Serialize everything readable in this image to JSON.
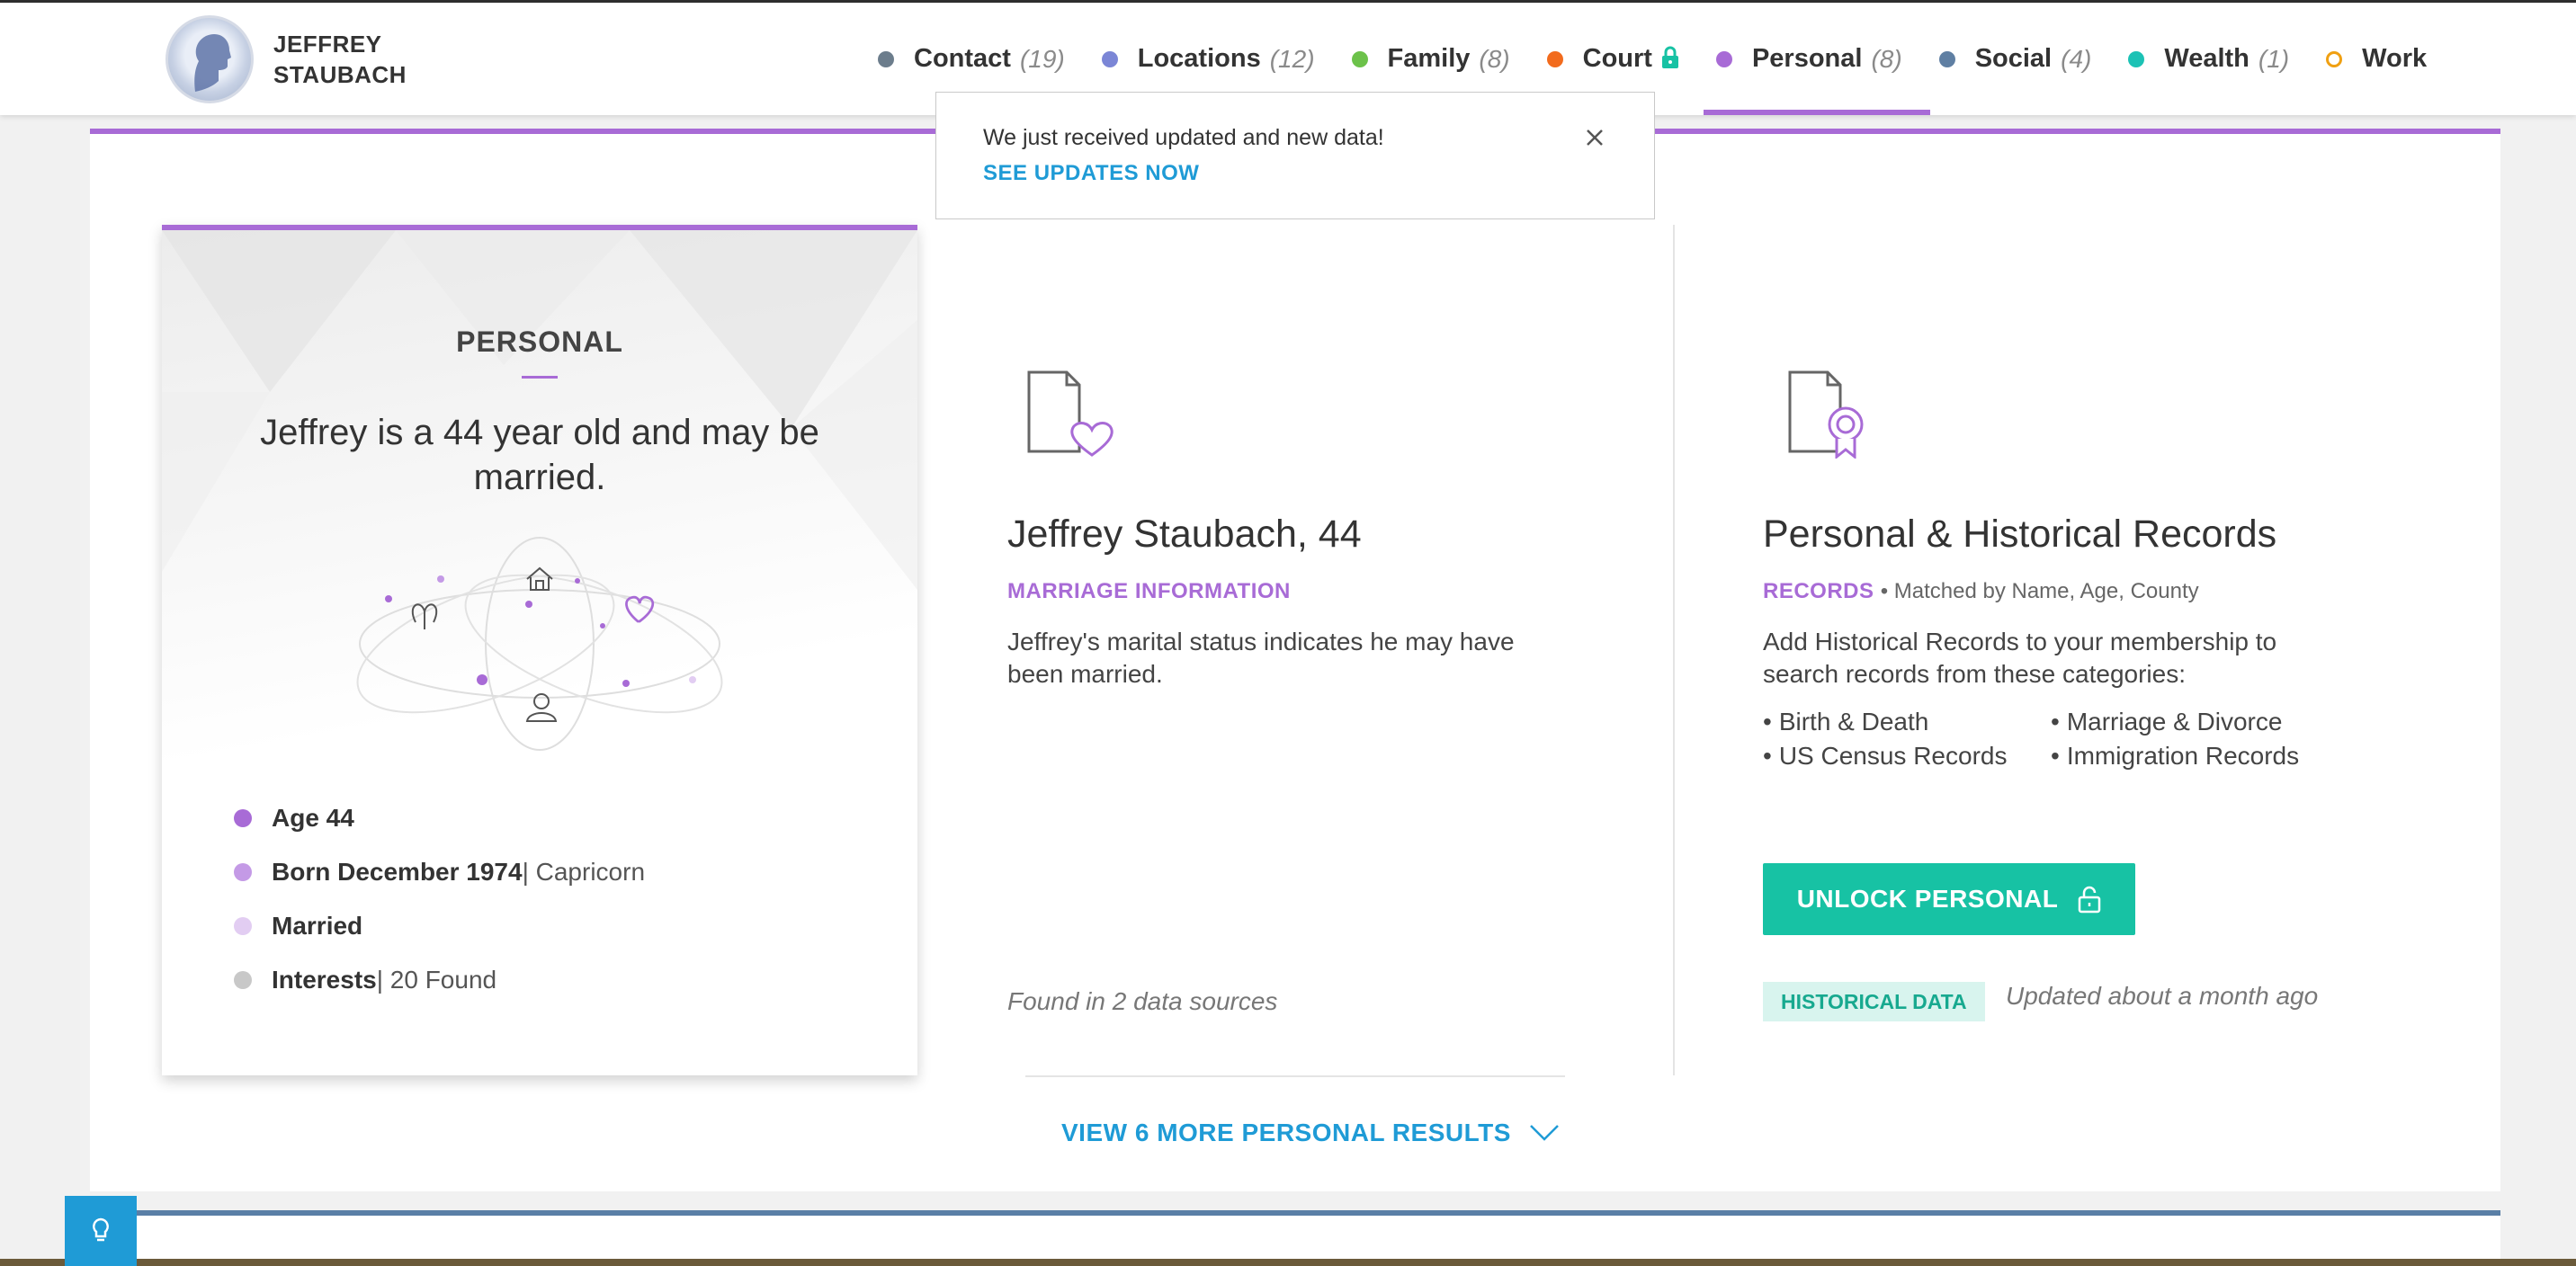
{
  "profile": {
    "name_line1": "JEFFREY",
    "name_line2": "STAUBACH"
  },
  "nav": [
    {
      "label": "Contact",
      "count": "(19)",
      "color": "#6c7d8c"
    },
    {
      "label": "Locations",
      "count": "(12)",
      "color": "#7b86d6"
    },
    {
      "label": "Family",
      "count": "(8)",
      "color": "#6cc24a"
    },
    {
      "label": "Court",
      "count": "",
      "color": "#f26b1d"
    },
    {
      "label": "Personal",
      "count": "(8)",
      "color": "#a86bd6",
      "active": true
    },
    {
      "label": "Social",
      "count": "(4)",
      "color": "#5f7fa3"
    },
    {
      "label": "Wealth",
      "count": "(1)",
      "color": "#1cc2b5"
    },
    {
      "label": "Work",
      "count": "",
      "color": "#f0a012"
    }
  ],
  "toast": {
    "message": "We just received updated and new data!",
    "link": "SEE UPDATES NOW"
  },
  "card": {
    "title": "PERSONAL",
    "summary": "Jeffrey is a 44 year old and may be married.",
    "facts": [
      {
        "label": "Age 44",
        "extra": "",
        "color": "#a86bd6"
      },
      {
        "label": "Born December 1974",
        "extra": " | Capricorn",
        "color": "#c49ae6"
      },
      {
        "label": "Married",
        "extra": "",
        "color": "#e2cdf2"
      },
      {
        "label": "Interests",
        "extra": " | 20 Found",
        "color": "#c8c8c8"
      }
    ]
  },
  "marriage": {
    "title": "Jeffrey Staubach, 44",
    "tag": "MARRIAGE INFORMATION",
    "description": "Jeffrey's marital status indicates he may have been married.",
    "found": "Found in 2 data sources"
  },
  "records": {
    "title": "Personal & Historical Records",
    "tag": "RECORDS",
    "tag_detail": "Matched by Name, Age, County",
    "description": "Add Historical Records to your membership to search records from these categories:",
    "categories": [
      "Birth & Death",
      "Marriage & Divorce",
      "US Census Records",
      "Immigration Records"
    ],
    "unlock_label": "UNLOCK PERSONAL",
    "badge": "HISTORICAL DATA",
    "updated": "Updated about a month ago"
  },
  "more_link": "VIEW 6 MORE PERSONAL RESULTS",
  "colors": {
    "accent": "#a86bd6",
    "teal": "#17c2a4",
    "link": "#1f9bd6"
  }
}
